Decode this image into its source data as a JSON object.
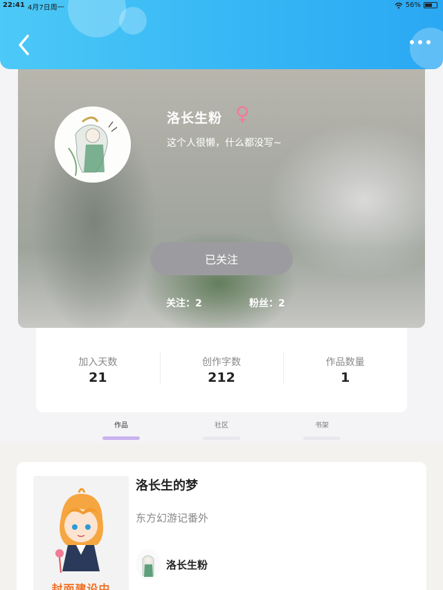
{
  "status_bar": {
    "time": "22:41",
    "date": "4月7日周一",
    "battery": "56%"
  },
  "header": {
    "back_icon": "chevron-left-icon",
    "more_icon": "more-horizontal-icon"
  },
  "profile": {
    "nickname": "洛长生粉",
    "gender_symbol": "♀",
    "bio": "这个人很懒，什么都没写~",
    "follow_button": "已关注",
    "following": "关注：2",
    "followers": "粉丝：2"
  },
  "stats": [
    {
      "label": "加入天数",
      "value": "21"
    },
    {
      "label": "创作字数",
      "value": "212"
    },
    {
      "label": "作品数量",
      "value": "1"
    }
  ],
  "tabs": [
    {
      "label": "作品",
      "active": true
    },
    {
      "label": "社区",
      "active": false
    },
    {
      "label": "书架",
      "active": false
    }
  ],
  "works": [
    {
      "cover_text": "封面建设中",
      "title": "洛长生的梦",
      "description": "东方幻游记番外",
      "author": "洛长生粉"
    }
  ],
  "colors": {
    "header": "#38b8f5",
    "accent_tab": "#c9b2ee",
    "gender": "#f07c96",
    "cover_text": "#f07024"
  }
}
